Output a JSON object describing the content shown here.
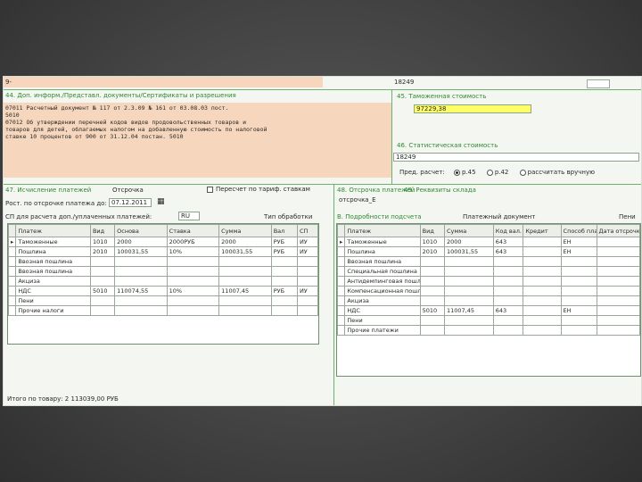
{
  "header": {
    "row_label": "9-",
    "number_field": "18249"
  },
  "box44": {
    "title": "44. Доп. информ./Представл. документы/Сертификаты и разрешения",
    "lines": [
      "07011 Расчетный документ № 117 от 2.3.09 № 161 от 03.08.03 пост.",
      "5010",
      "07012 Об утверждении перечней кодов видов продовольственных товаров и",
      "товаров для детей, облагаемых налогом на добавленную стоимость по налоговой",
      "ставке 10 процентов от 900 от 31.12.04 постан. 5010"
    ]
  },
  "box45": {
    "title": "45. Таможенная стоимость",
    "value": "97229,38"
  },
  "box46": {
    "title": "46. Статистическая стоимость",
    "value": "18249"
  },
  "box46_opts": {
    "label": "Пред. расчет:",
    "opt1": "р.45",
    "opt2": "р.42",
    "opt3": "рассчитать вручную"
  },
  "box47": {
    "title": "47. Исчисление платежей",
    "deferred": "Отсрочка",
    "checkbox_label": "Пересчет по тариф. ставкам",
    "deferral_label": "Рост. по отсрочке платежа до:",
    "deferral_date": "07.12.2011",
    "currency_label": "СП для расчета доп./уплаченных платежей:",
    "currency_value": "RU",
    "method_label": "Тип обработки",
    "columns": [
      "Платеж",
      "Вид",
      "Основа",
      "Ставка",
      "Сумма",
      "Вал",
      "СП"
    ],
    "rows": [
      [
        "Таможенные",
        "1010",
        "2000",
        "2000РУБ",
        "2000",
        "РУБ",
        "ИУ"
      ],
      [
        "Пошлина",
        "2010",
        "100031,55",
        "10%",
        "100031,55",
        "РУБ",
        "ИУ"
      ],
      [
        "Ввозная пошлина",
        "",
        "",
        "",
        "",
        "",
        ""
      ],
      [
        "Ввозная пошлина",
        "",
        "",
        "",
        "",
        "",
        ""
      ],
      [
        "Акциза",
        "",
        "",
        "",
        "",
        "",
        ""
      ],
      [
        "НДС",
        "5010",
        "110074,55",
        "10%",
        "11007,45",
        "РУБ",
        "ИУ"
      ],
      [
        "Пени",
        "",
        "",
        "",
        "",
        "",
        ""
      ],
      [
        "Прочие налоги",
        "",
        "",
        "",
        "",
        "",
        ""
      ]
    ],
    "footer": "Итого по товару: 2 113039,00 РУБ"
  },
  "box48": {
    "title": "48. Отсрочка платежей",
    "value": "отсрочка_Е"
  },
  "box49": {
    "title": "49. Реквизиты склада"
  },
  "boxB": {
    "title": "В. Подробности подсчета",
    "doc_label": "Платежный документ",
    "extra_label": "Пени",
    "columns": [
      "Платеж",
      "Вид",
      "Сумма",
      "Код вал.",
      "Кредит",
      "Способ платежа",
      "Дата отсрочки"
    ],
    "rows": [
      [
        "Таможенные",
        "1010",
        "2000",
        "643",
        "",
        "ЕН",
        ""
      ],
      [
        "Пошлина",
        "2010",
        "100031,55",
        "643",
        "",
        "ЕН",
        ""
      ],
      [
        "Ввозная пошлина",
        "",
        "",
        "",
        "",
        "",
        ""
      ],
      [
        "Специальная пошлина",
        "",
        "",
        "",
        "",
        "",
        ""
      ],
      [
        "Антидемпинговая пошлина",
        "",
        "",
        "",
        "",
        "",
        ""
      ],
      [
        "Компенсационная пошлина",
        "",
        "",
        "",
        "",
        "",
        ""
      ],
      [
        "Акциза",
        "",
        "",
        "",
        "",
        "",
        ""
      ],
      [
        "НДС",
        "5010",
        "11007,45",
        "643",
        "",
        "ЕН",
        ""
      ],
      [
        "Пени",
        "",
        "",
        "",
        "",
        "",
        ""
      ],
      [
        "Прочие платежи",
        "",
        "",
        "",
        "",
        "",
        ""
      ]
    ]
  }
}
